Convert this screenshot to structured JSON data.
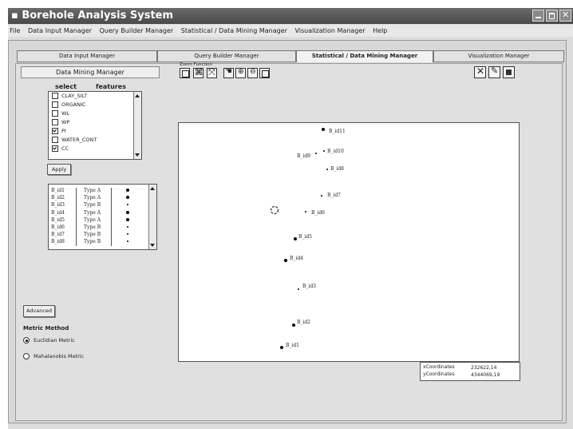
{
  "window": {
    "title": "Borehole Analysis System"
  },
  "menu": [
    "File",
    "Data Input Manager",
    "Query Builder Manager",
    "Statistical / Data Mining Manager",
    "Visualization Manager",
    "Help"
  ],
  "tabs": [
    "Data Input Manager",
    "Query Builder Manager",
    "Statistical / Data Mining Manager",
    "Visualization Manager"
  ],
  "active_tab": "Statistical / Data Mining Manager",
  "panel": {
    "title": "Data Mining Manager",
    "select_label": "select",
    "features_label": "features",
    "features": [
      {
        "name": "CLAY_SILT",
        "checked": false
      },
      {
        "name": "ORGANIC",
        "checked": false
      },
      {
        "name": "WL",
        "checked": false
      },
      {
        "name": "WP",
        "checked": false
      },
      {
        "name": "PI",
        "checked": true
      },
      {
        "name": "WATER_CONT",
        "checked": false
      },
      {
        "name": "CC",
        "checked": true
      }
    ],
    "apply_label": "Apply",
    "results": [
      {
        "id": "B_id1",
        "type": "Type A",
        "marker": "large"
      },
      {
        "id": "B_id2",
        "type": "Type A",
        "marker": "large"
      },
      {
        "id": "B_id3",
        "type": "Type B",
        "marker": "small"
      },
      {
        "id": "B_id4",
        "type": "Type A",
        "marker": "large"
      },
      {
        "id": "B_id5",
        "type": "Type A",
        "marker": "large"
      },
      {
        "id": "B_id6",
        "type": "Type B",
        "marker": "small"
      },
      {
        "id": "B_id7",
        "type": "Type B",
        "marker": "small"
      },
      {
        "id": "B_id8",
        "type": "Type B",
        "marker": "small"
      }
    ],
    "advanced_label": "Advanced",
    "metric_title": "Metric Method",
    "metrics": [
      {
        "label": "Euclidian Metric",
        "selected": true
      },
      {
        "label": "Mahalanobis Metric",
        "selected": false
      }
    ]
  },
  "zoom": {
    "label": "Zoom Function",
    "tool_icons": [
      "save-icon",
      "zoom-extent-icon",
      "zoom-fit-icon",
      "pan-hand-icon",
      "zoom-in-icon",
      "zoom-out-icon",
      "zoom-reset-icon"
    ]
  },
  "plot_tools": [
    "close-icon",
    "edit-icon",
    "print-icon"
  ],
  "plot_points": [
    {
      "label": "B_id11",
      "size": "large"
    },
    {
      "label": "B_id9",
      "size": "small"
    },
    {
      "label": "B_id10",
      "size": "small"
    },
    {
      "label": "B_id8",
      "size": "small"
    },
    {
      "label": "B_id7",
      "size": "small"
    },
    {
      "label": "B_id6",
      "size": "small"
    },
    {
      "label": "B_id5",
      "size": "large"
    },
    {
      "label": "B_id4",
      "size": "large"
    },
    {
      "label": "B_id3",
      "size": "small"
    },
    {
      "label": "B_id2",
      "size": "large"
    },
    {
      "label": "B_id1",
      "size": "large"
    }
  ],
  "coordinates": {
    "x_label": "xCoordinates",
    "x_value": "232622,14",
    "y_label": "yCoordinates",
    "y_value": "4344069,19"
  }
}
